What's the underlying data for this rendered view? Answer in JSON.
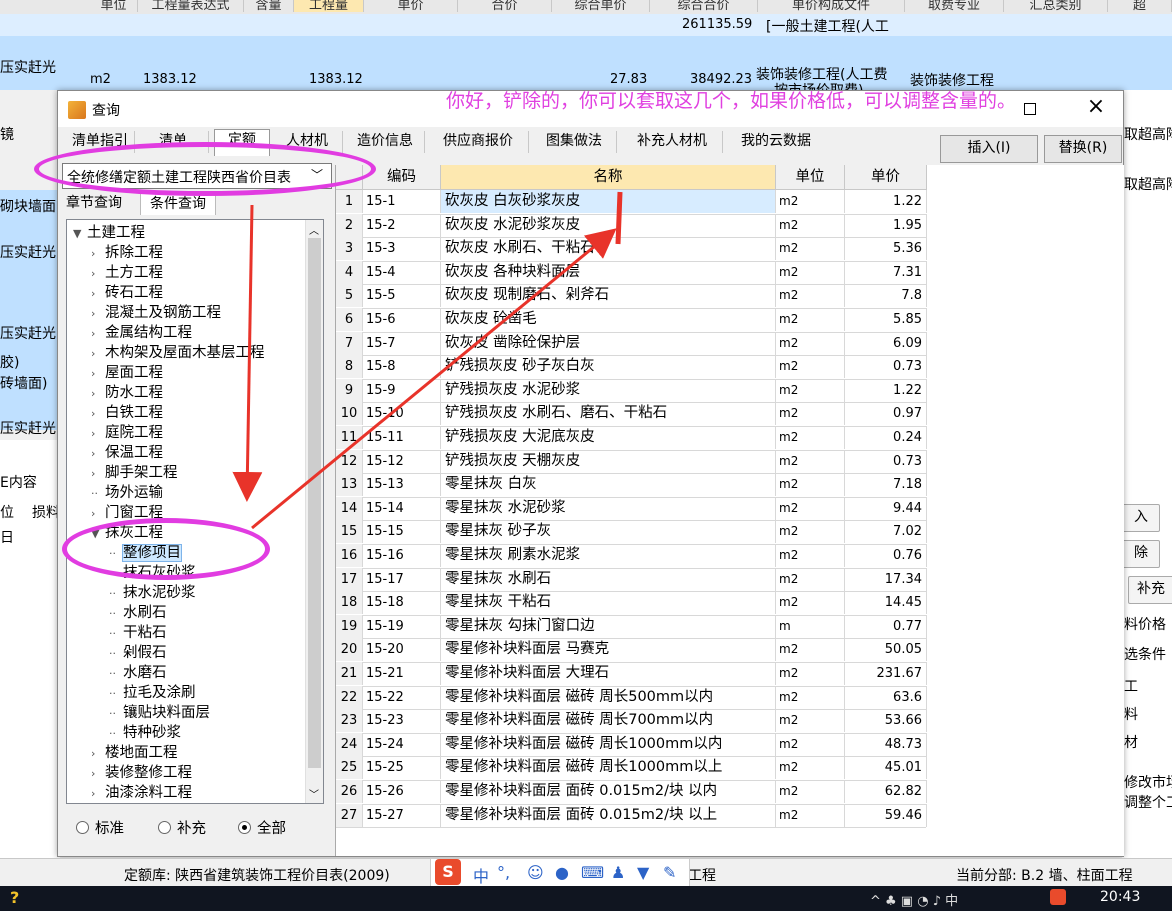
{
  "background": {
    "header_labels": [
      "单位",
      "工程量表达式",
      "含量",
      "工程量",
      "单价",
      "合价",
      "综合单价",
      "综合合价",
      "单价构成文件",
      "取费专业",
      "汇总类别",
      "超"
    ],
    "sum_value": "261135.59",
    "sum_template": "[一般土建工程(人工",
    "row1": {
      "unit": "m2",
      "expr": "1383.12",
      "qty": "1383.12",
      "unit_price": "27.83",
      "total": "38492.23",
      "template": "装饰装修工程(人工费",
      "template2": "按市场价取费)",
      "fee": "装饰装修工程"
    },
    "left_fragments": [
      "压实赶光",
      "镜",
      "砌块墙面)",
      "压实赶光",
      "压实赶光",
      "胶)",
      "砖墙面)",
      "压实赶光",
      "E内容",
      "位",
      "损料",
      "日"
    ],
    "right_fragments": [
      "取超高降",
      "取超高降",
      "入",
      "除",
      "补充",
      "料价格",
      "选条件",
      "工",
      "料",
      "材",
      "修改市场",
      "调整个工"
    ]
  },
  "dialog": {
    "title": "查询",
    "tabs": [
      "清单指引",
      "清单",
      "定额",
      "人材机",
      "造价信息",
      "供应商报价",
      "图集做法",
      "补充人材机",
      "我的云数据"
    ],
    "active_tab": 2,
    "insert_button": "插入(I)",
    "replace_button": "替换(R)",
    "library_select": "全统修缮定额土建工程陕西省价目表",
    "subtabs": [
      "章节查询",
      "条件查询"
    ],
    "tree": [
      {
        "label": "土建工程",
        "level": 0,
        "expanded": true
      },
      {
        "label": "拆除工程",
        "level": 1
      },
      {
        "label": "土方工程",
        "level": 1
      },
      {
        "label": "砖石工程",
        "level": 1
      },
      {
        "label": "混凝土及钢筋工程",
        "level": 1
      },
      {
        "label": "金属结构工程",
        "level": 1
      },
      {
        "label": "木构架及屋面木基层工程",
        "level": 1
      },
      {
        "label": "屋面工程",
        "level": 1
      },
      {
        "label": "防水工程",
        "level": 1
      },
      {
        "label": "白铁工程",
        "level": 1
      },
      {
        "label": "庭院工程",
        "level": 1
      },
      {
        "label": "保温工程",
        "level": 1
      },
      {
        "label": "脚手架工程",
        "level": 1
      },
      {
        "label": "场外运输",
        "level": 1,
        "leaf": true
      },
      {
        "label": "门窗工程",
        "level": 1
      },
      {
        "label": "抹灰工程",
        "level": 1,
        "expanded": true
      },
      {
        "label": "整修项目",
        "level": 2,
        "selected": true
      },
      {
        "label": "抹石灰砂浆",
        "level": 2
      },
      {
        "label": "抹水泥砂浆",
        "level": 2
      },
      {
        "label": "水刷石",
        "level": 2
      },
      {
        "label": "干粘石",
        "level": 2
      },
      {
        "label": "剁假石",
        "level": 2
      },
      {
        "label": "水磨石",
        "level": 2
      },
      {
        "label": "拉毛及涂刷",
        "level": 2
      },
      {
        "label": "镶贴块料面层",
        "level": 2
      },
      {
        "label": "特种砂浆",
        "level": 2
      },
      {
        "label": "楼地面工程",
        "level": 1
      },
      {
        "label": "装修整修工程",
        "level": 1
      },
      {
        "label": "油漆涂料工程",
        "level": 1
      }
    ],
    "radios": [
      "标准",
      "补充",
      "全部"
    ],
    "radio_selected": 2,
    "grid_headers": [
      "编码",
      "名称",
      "单位",
      "单价"
    ],
    "rows": [
      [
        "1",
        "15-1",
        "砍灰皮 白灰砂浆灰皮",
        "m2",
        "1.22"
      ],
      [
        "2",
        "15-2",
        "砍灰皮 水泥砂浆灰皮",
        "m2",
        "1.95"
      ],
      [
        "3",
        "15-3",
        "砍灰皮 水刷石、干粘石",
        "m2",
        "5.36"
      ],
      [
        "4",
        "15-4",
        "砍灰皮 各种块料面层",
        "m2",
        "7.31"
      ],
      [
        "5",
        "15-5",
        "砍灰皮 现制磨石、剁斧石",
        "m2",
        "7.8"
      ],
      [
        "6",
        "15-6",
        "砍灰皮 砼凿毛",
        "m2",
        "5.85"
      ],
      [
        "7",
        "15-7",
        "砍灰皮 凿除砼保护层",
        "m2",
        "6.09"
      ],
      [
        "8",
        "15-8",
        "铲残损灰皮 砂子灰白灰",
        "m2",
        "0.73"
      ],
      [
        "9",
        "15-9",
        "铲残损灰皮 水泥砂浆",
        "m2",
        "1.22"
      ],
      [
        "10",
        "15-10",
        "铲残损灰皮 水刷石、磨石、干粘石",
        "m2",
        "0.97"
      ],
      [
        "11",
        "15-11",
        "铲残损灰皮 大泥底灰皮",
        "m2",
        "0.24"
      ],
      [
        "12",
        "15-12",
        "铲残损灰皮 天棚灰皮",
        "m2",
        "0.73"
      ],
      [
        "13",
        "15-13",
        "零星抹灰 白灰",
        "m2",
        "7.18"
      ],
      [
        "14",
        "15-14",
        "零星抹灰 水泥砂浆",
        "m2",
        "9.44"
      ],
      [
        "15",
        "15-15",
        "零星抹灰 砂子灰",
        "m2",
        "7.02"
      ],
      [
        "16",
        "15-16",
        "零星抹灰 刷素水泥浆",
        "m2",
        "0.76"
      ],
      [
        "17",
        "15-17",
        "零星抹灰 水刷石",
        "m2",
        "17.34"
      ],
      [
        "18",
        "15-18",
        "零星抹灰 干粘石",
        "m2",
        "14.45"
      ],
      [
        "19",
        "15-19",
        "零星抹灰 勾抹门窗口边",
        "m",
        "0.77"
      ],
      [
        "20",
        "15-20",
        "零星修补块料面层 马赛克",
        "m2",
        "50.05"
      ],
      [
        "21",
        "15-21",
        "零星修补块料面层 大理石",
        "m2",
        "231.67"
      ],
      [
        "22",
        "15-22",
        "零星修补块料面层 磁砖 周长500mm以内",
        "m2",
        "63.6"
      ],
      [
        "23",
        "15-23",
        "零星修补块料面层 磁砖 周长700mm以内",
        "m2",
        "53.66"
      ],
      [
        "24",
        "15-24",
        "零星修补块料面层 磁砖 周长1000mm以内",
        "m2",
        "48.73"
      ],
      [
        "25",
        "15-25",
        "零星修补块料面层 磁砖 周长1000mm以上",
        "m2",
        "45.01"
      ],
      [
        "26",
        "15-26",
        "零星修补块料面层 面砖 0.015m2/块 以内",
        "m2",
        "62.82"
      ],
      [
        "27",
        "15-27",
        "零星修补块料面层 面砖 0.015m2/块 以上",
        "m2",
        "59.46"
      ]
    ]
  },
  "annotation": {
    "text": "你好，铲除的，你可以套取这几个，如果价格低，可以调整含量的。",
    "color": "#e040e0"
  },
  "status": {
    "library": "定额库: 陕西省建筑装饰工程价目表(2009)",
    "part_label": "工程",
    "current": "当前分部: B.2  墙、柱面工程"
  },
  "taskbar": {
    "clock": "20:43"
  }
}
